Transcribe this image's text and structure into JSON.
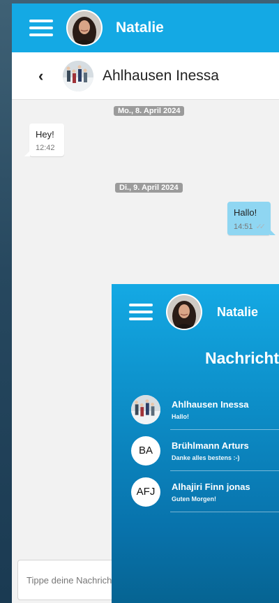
{
  "user": {
    "name": "Natalie"
  },
  "chat": {
    "contact_name": "Ahlhausen Inessa",
    "back_icon": "chevron-left-icon",
    "groups": [
      {
        "date": "Mo., 8. April 2024",
        "messages": [
          {
            "text": "Hey!",
            "time": "12:42",
            "direction": "incoming"
          }
        ]
      },
      {
        "date": "Di., 9. April 2024",
        "messages": [
          {
            "text": "Hallo!",
            "time": "14:51",
            "direction": "outgoing",
            "status": "read"
          }
        ]
      }
    ],
    "composer": {
      "placeholder": "Tippe deine Nachricht..."
    }
  },
  "conversations": {
    "title": "Nachrichten",
    "items": [
      {
        "name": "Ahlhausen Inessa",
        "preview": "Hallo!",
        "avatar": "photo"
      },
      {
        "name": "Brühlmann Arturs",
        "preview": "Danke alles bestens :-)",
        "avatar": "BA"
      },
      {
        "name": "Alhajiri Finn jonas",
        "preview": "Guten Morgen!",
        "avatar": "AFJ"
      }
    ]
  },
  "colors": {
    "primary": "#14a9e4",
    "outgoing_bubble": "#8fd6f2",
    "chat_background": "#f2f2f2"
  }
}
